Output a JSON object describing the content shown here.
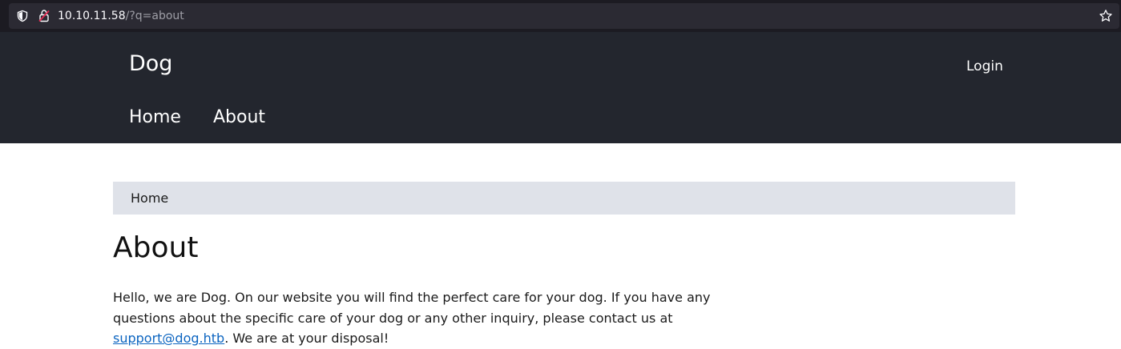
{
  "browser": {
    "url_host": "10.10.11.58",
    "url_path": "/?q=about"
  },
  "site": {
    "name": "Dog",
    "login_label": "Login",
    "menu": [
      {
        "label": "Home"
      },
      {
        "label": "About"
      }
    ]
  },
  "breadcrumb": {
    "home_label": "Home"
  },
  "page": {
    "title": "About",
    "paragraph_before_link": "Hello, we are Dog. On our website you will find the perfect care for your dog. If you have any questions about the specific care of your dog or any other inquiry, please contact us at ",
    "email_link": "support@dog.htb",
    "paragraph_after_link": ". We are at your disposal!"
  },
  "colors": {
    "header_bg": "#23262e",
    "breadcrumb_bg": "#dfe2e9",
    "link": "#0b64c0"
  }
}
